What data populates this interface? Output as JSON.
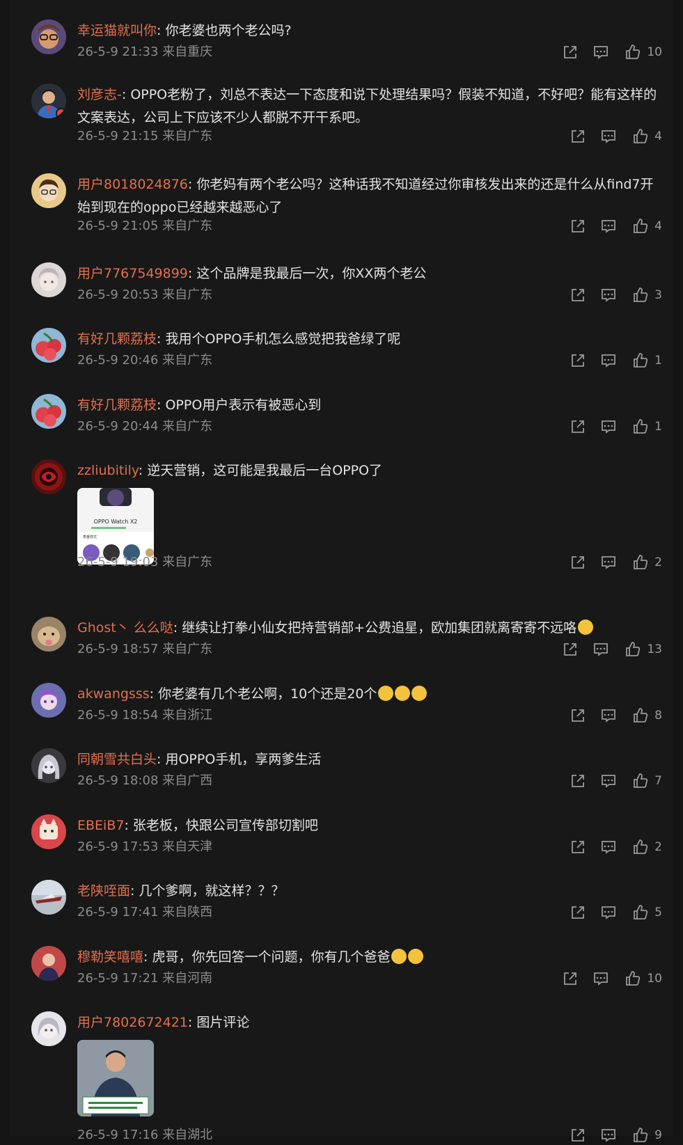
{
  "comments": [
    {
      "username": "幸运猫就叫你",
      "sep": ": ",
      "text": "你老婆也两个老公吗?",
      "time": "26-5-9 21:33",
      "location": "来自重庆",
      "likes": "10"
    },
    {
      "username": "刘彦志-",
      "sep": ": ",
      "text": "OPPO老粉了，刘总不表达一下态度和说下处理结果吗？假装不知道，不好吧？能有这样的文案表达，公司上下应该不少人都脱不开干系吧。",
      "time": "26-5-9 21:15",
      "location": "来自广东",
      "likes": "4"
    },
    {
      "username": "用户8018024876",
      "sep": ": ",
      "text": "你老妈有两个老公吗？这种话我不知道经过你审核发出来的还是什么从find7开始到现在的oppo已经越来越恶心了",
      "time": "26-5-9 21:05",
      "location": "来自广东",
      "likes": "4"
    },
    {
      "username": "用户7767549899",
      "sep": ": ",
      "text": "这个品牌是我最后一次，你XX两个老公",
      "time": "26-5-9 20:53",
      "location": "来自广东",
      "likes": "3"
    },
    {
      "username": "有好几颗荔枝",
      "sep": ": ",
      "text": "我用个OPPO手机怎么感觉把我爸绿了呢",
      "time": "26-5-9 20:46",
      "location": "来自广东",
      "likes": "1"
    },
    {
      "username": "有好几颗荔枝",
      "sep": ": ",
      "text": "OPPO用户表示有被恶心到",
      "time": "26-5-9 20:44",
      "location": "来自广东",
      "likes": "1"
    },
    {
      "username": "zzliubitily",
      "sep": ": ",
      "text": "逆天营销，这可能是我最后一台OPPO了",
      "time": "26-5-9 19:03",
      "location": "来自广东",
      "likes": "2",
      "image_text": "OPPO Watch X2",
      "image_subtext": "表盘样式"
    },
    {
      "username": "Ghost丶 么么哒",
      "sep": ": ",
      "text": "继续让打拳小仙女把持营销部+公费追星，欧加集团就离寄寄不远咯",
      "time": "26-5-9 18:57",
      "location": "来自广东",
      "likes": "13"
    },
    {
      "username": "akwangsss",
      "sep": ": ",
      "text": "你老婆有几个老公啊，10个还是20个",
      "time": "26-5-9 18:54",
      "location": "来自浙江",
      "likes": "8"
    },
    {
      "username": "同朝雪共白头",
      "sep": ": ",
      "text": "用OPPO手机，享两爹生活",
      "time": "26-5-9 18:08",
      "location": "来自广西",
      "likes": "7"
    },
    {
      "username": "EBEiB7",
      "sep": ": ",
      "text": "张老板，快跟公司宣传部切割吧",
      "time": "26-5-9 17:53",
      "location": "来自天津",
      "likes": "2"
    },
    {
      "username": "老陕咥面",
      "sep": ": ",
      "text": "几个爹啊，就这样？？？",
      "time": "26-5-9 17:41",
      "location": "来自陕西",
      "likes": "5"
    },
    {
      "username": "穆勒笑嘻嘻",
      "sep": ": ",
      "text": "虎哥，你先回答一个问题，你有几个爸爸",
      "time": "26-5-9 17:21",
      "location": "来自河南",
      "likes": "10"
    },
    {
      "username": "用户7802672421",
      "sep": ": ",
      "text": "图片评论",
      "time": "26-5-9 17:16",
      "location": "来自湖北",
      "likes": "9"
    }
  ],
  "colors": {
    "background": "#181818",
    "username": "#e2704e",
    "text": "#e3e3e3",
    "meta": "#8c8c8c",
    "icon": "#9a9a9a"
  },
  "icons": {
    "share": "share-icon",
    "reply": "comment-icon",
    "like": "thumbs-up-icon"
  }
}
